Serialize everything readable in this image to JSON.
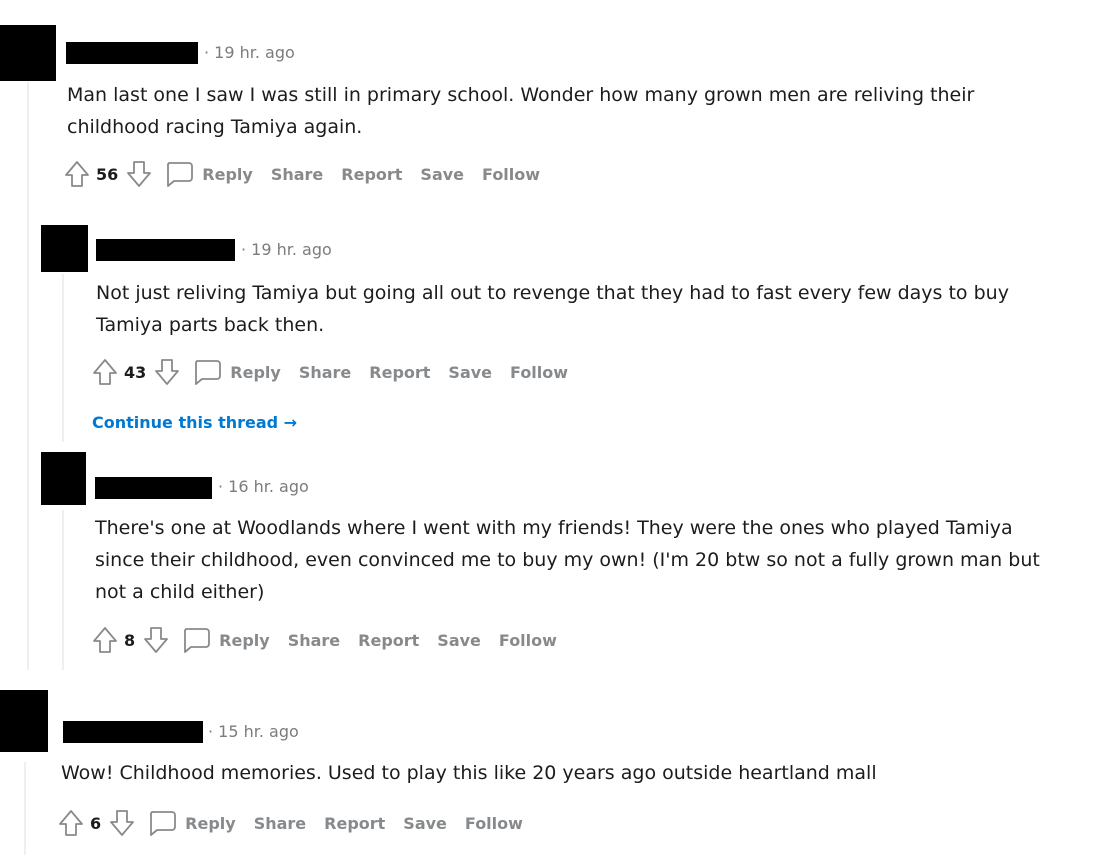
{
  "comments": [
    {
      "time": "· 19 hr. ago",
      "body": "Man last one I saw I was still in primary school. Wonder how many grown men are reliving their childhood racing Tamiya again.",
      "score": "56"
    },
    {
      "time": "· 19 hr. ago",
      "body": "Not just reliving Tamiya but going all out to revenge that they had to fast every few days to buy Tamiya parts back then.",
      "score": "43"
    },
    {
      "time": "· 16 hr. ago",
      "body": "There's one at Woodlands where I went with my friends! They were the ones who played Tamiya since their childhood, even convinced me to buy my own! (I'm 20 btw so not a fully grown man but not a child either)",
      "score": "8"
    },
    {
      "time": "· 15 hr. ago",
      "body": "Wow! Childhood memories. Used to play this like 20 years ago outside heartland mall",
      "score": "6"
    }
  ],
  "actions": {
    "reply": "Reply",
    "share": "Share",
    "report": "Report",
    "save": "Save",
    "follow": "Follow"
  },
  "continue_thread": "Continue this thread →",
  "icons": [
    "upvote-arrow-icon",
    "downvote-arrow-icon",
    "comment-bubble-icon"
  ],
  "colors": {
    "link": "#0079d3",
    "meta": "#7c7c7c",
    "action": "#878a8c",
    "redaction": "#000000"
  }
}
